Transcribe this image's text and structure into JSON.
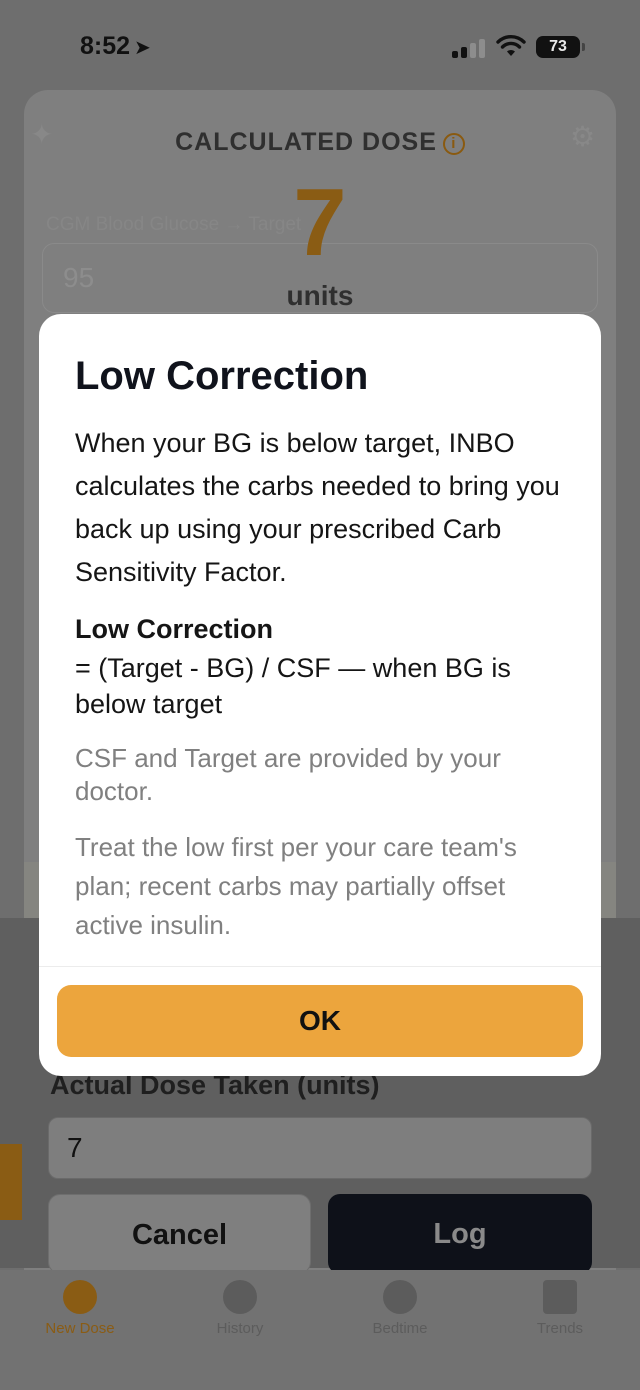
{
  "status_bar": {
    "time": "8:52",
    "battery": "73"
  },
  "calculator": {
    "title": "CALCULATED DOSE",
    "dose_value": "7",
    "dose_units": "units",
    "cgm_label": "CGM Blood Glucose → Target",
    "cgm_value": "95",
    "actual_dose_label": "Actual Dose Taken (units)",
    "actual_dose_value": "7",
    "cancel_label": "Cancel",
    "log_label": "Log"
  },
  "tabs": [
    {
      "label": "New Dose",
      "active": true
    },
    {
      "label": "History",
      "active": false
    },
    {
      "label": "Bedtime",
      "active": false
    },
    {
      "label": "Trends",
      "active": false
    }
  ],
  "modal": {
    "title": "Low Correction",
    "body": "When your BG is below target, INBO calculates the carbs needed to bring you back up using your prescribed Carb Sensitivity Factor.",
    "formula_heading": "Low Correction",
    "formula": "= (Target - BG) / CSF — when BG is below target",
    "note1": "CSF and Target are provided by your doctor.",
    "note2": "Treat the low first per your care team's plan; recent carbs may partially offset active insulin.",
    "ok_label": "OK"
  },
  "colors": {
    "accent": "#eca53d",
    "accent_dimmed": "#8a5c14",
    "dark_button": "#0e1119",
    "title_text": "#10131c"
  }
}
